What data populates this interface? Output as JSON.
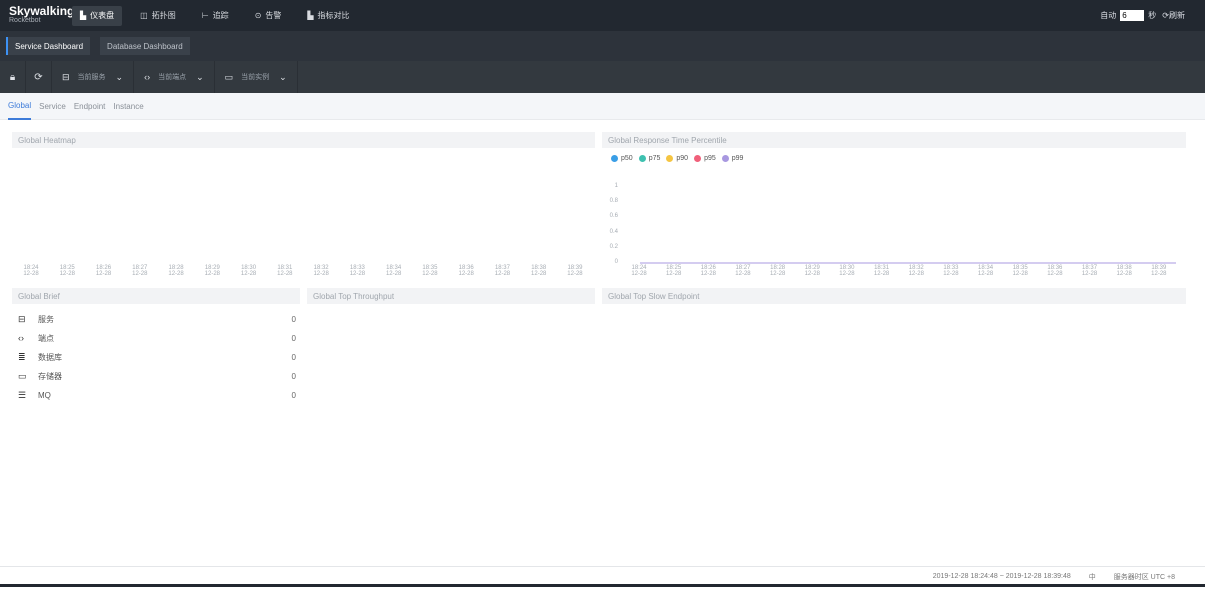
{
  "app": {
    "name": "Skywalking",
    "sub": "Rocketbot"
  },
  "nav": [
    {
      "icon": "▙",
      "label": "仪表盘"
    },
    {
      "icon": "◫",
      "label": "拓扑图"
    },
    {
      "icon": "⊢",
      "label": "追踪"
    },
    {
      "icon": "⊙",
      "label": "告警"
    },
    {
      "icon": "▙",
      "label": "指标对比"
    }
  ],
  "auto_refresh": {
    "label": "自动",
    "value": "6",
    "unit": "秒",
    "refresh_label": "刷新"
  },
  "dashboards": [
    "Service Dashboard",
    "Database Dashboard"
  ],
  "toolbar": {
    "service": "当前服务",
    "endpoint": "当前端点",
    "instance": "当前实例"
  },
  "subtabs": [
    "Global",
    "Service",
    "Endpoint",
    "Instance"
  ],
  "panels": {
    "heatmap": "Global Heatmap",
    "percentile": "Global Response Time Percentile",
    "brief": "Global Brief",
    "throughput": "Global Top Throughput",
    "slow": "Global Top Slow Endpoint"
  },
  "legend": [
    {
      "name": "p50",
      "color": "#3a9ee6"
    },
    {
      "name": "p75",
      "color": "#3fc1b0"
    },
    {
      "name": "p90",
      "color": "#f5c542"
    },
    {
      "name": "p95",
      "color": "#f0607a"
    },
    {
      "name": "p99",
      "color": "#a898e0"
    }
  ],
  "y_ticks": [
    "1",
    "0.8",
    "0.6",
    "0.4",
    "0.2",
    "0"
  ],
  "time_ticks": [
    "18:24",
    "18:25",
    "18:26",
    "18:27",
    "18:28",
    "18:29",
    "18:30",
    "18:31",
    "18:32",
    "18:33",
    "18:34",
    "18:35",
    "18:36",
    "18:37",
    "18:38",
    "18:39"
  ],
  "date_label": "12-28",
  "brief": [
    {
      "icon": "service-icon",
      "glyph": "⊟",
      "label": "服务",
      "value": "0"
    },
    {
      "icon": "endpoint-icon",
      "glyph": "‹›",
      "label": "端点",
      "value": "0"
    },
    {
      "icon": "database-icon",
      "glyph": "≣",
      "label": "数据库",
      "value": "0"
    },
    {
      "icon": "storage-icon",
      "glyph": "▭",
      "label": "存储器",
      "value": "0"
    },
    {
      "icon": "mq-icon",
      "glyph": "☰",
      "label": "MQ",
      "value": "0"
    }
  ],
  "chart_data": {
    "type": "line",
    "title": "Global Response Time Percentile",
    "x": [
      "18:24",
      "18:25",
      "18:26",
      "18:27",
      "18:28",
      "18:29",
      "18:30",
      "18:31",
      "18:32",
      "18:33",
      "18:34",
      "18:35",
      "18:36",
      "18:37",
      "18:38",
      "18:39"
    ],
    "series": [
      {
        "name": "p50",
        "values": [
          0,
          0,
          0,
          0,
          0,
          0,
          0,
          0,
          0,
          0,
          0,
          0,
          0,
          0,
          0,
          0
        ]
      },
      {
        "name": "p75",
        "values": [
          0,
          0,
          0,
          0,
          0,
          0,
          0,
          0,
          0,
          0,
          0,
          0,
          0,
          0,
          0,
          0
        ]
      },
      {
        "name": "p90",
        "values": [
          0,
          0,
          0,
          0,
          0,
          0,
          0,
          0,
          0,
          0,
          0,
          0,
          0,
          0,
          0,
          0
        ]
      },
      {
        "name": "p95",
        "values": [
          0,
          0,
          0,
          0,
          0,
          0,
          0,
          0,
          0,
          0,
          0,
          0,
          0,
          0,
          0,
          0
        ]
      },
      {
        "name": "p99",
        "values": [
          0,
          0,
          0,
          0,
          0,
          0,
          0,
          0,
          0,
          0,
          0,
          0,
          0,
          0,
          0,
          0
        ]
      }
    ],
    "ylim": [
      0,
      1
    ]
  },
  "footer": {
    "range": "2019-12-28 18:24:48 ~ 2019-12-28 18:39:48",
    "lang": "中",
    "timezone": "服务器时区 UTC +8"
  }
}
